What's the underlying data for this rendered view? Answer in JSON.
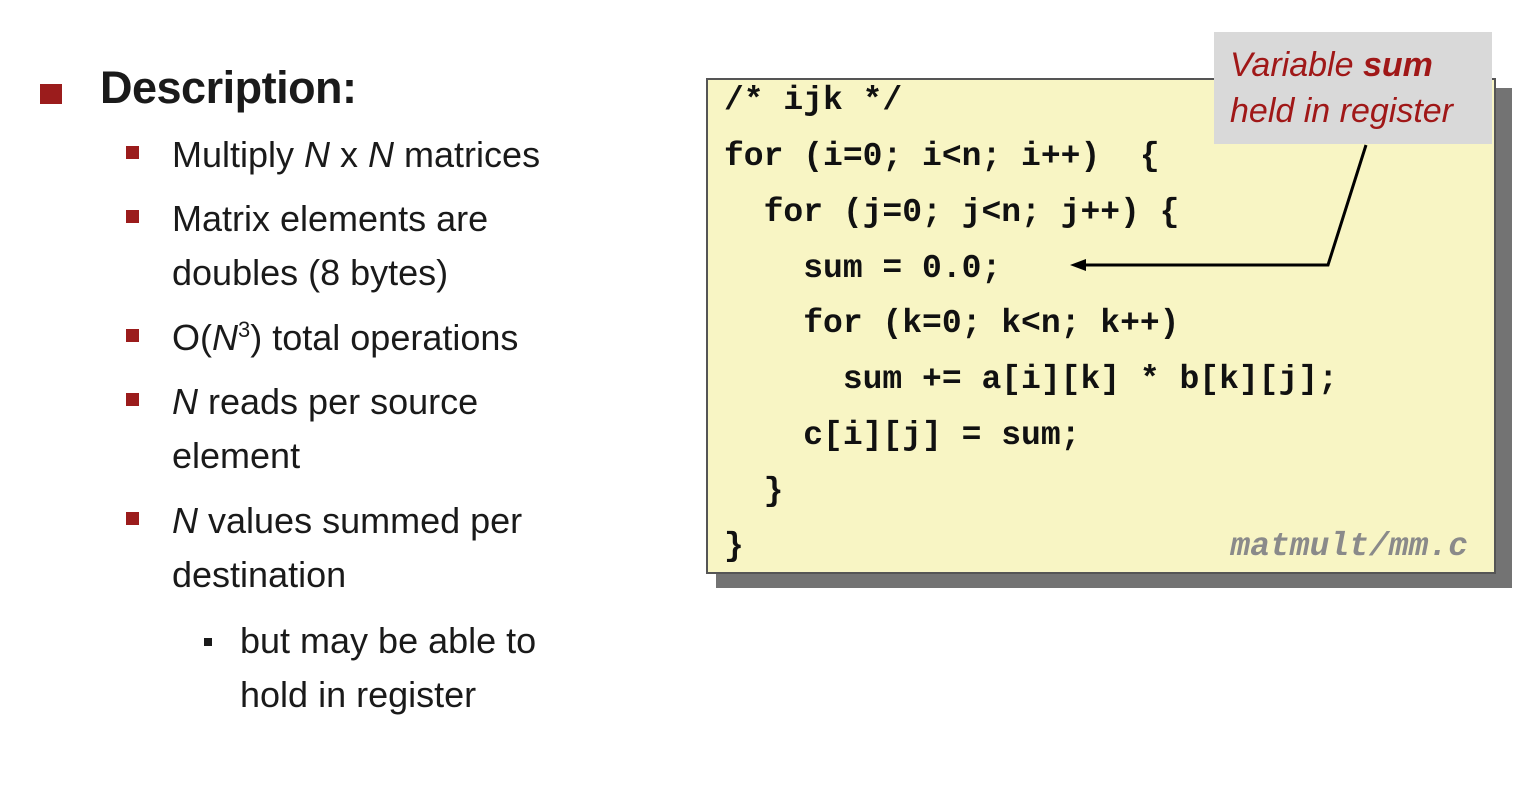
{
  "description": {
    "heading": "Description:",
    "items": [
      {
        "pre": "Multiply ",
        "n1": "N",
        "mid": " x ",
        "n2": "N",
        "post": " matrices"
      },
      {
        "line1": "Matrix elements are",
        "line2": "doubles (8 bytes)"
      },
      {
        "pre": "O(",
        "n": "N",
        "sup": "3",
        "post": ") total operations"
      },
      {
        "n": "N",
        "post": " reads per source",
        "line2": "element"
      },
      {
        "n": "N",
        "post": " values summed per",
        "line2": "destination"
      }
    ],
    "sub_item": {
      "line1": "but may be able to",
      "line2": "hold in register"
    }
  },
  "code": {
    "lines": [
      "/* ijk */",
      "for (i=0; i<n; i++)  {",
      "  for (j=0; j<n; j++) {",
      "    sum = 0.0;",
      "    for (k=0; k<n; k++)",
      "      sum += a[i][k] * b[k][j];",
      "    c[i][j] = sum;",
      "  }",
      "}"
    ],
    "filename": "matmult/mm.c"
  },
  "callout": {
    "line1_pre": "Variable ",
    "line1_bold": "sum",
    "line2": "held in register"
  },
  "colors": {
    "bullet": "#9b1c1c",
    "callout_text": "#a01818",
    "code_bg": "#f8f5c4",
    "callout_bg": "#d9d9d9"
  }
}
